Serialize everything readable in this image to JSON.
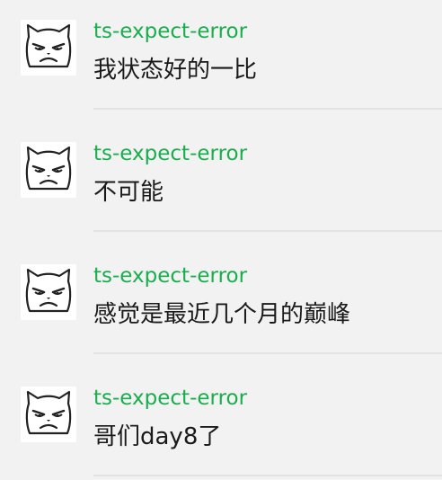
{
  "messages": [
    {
      "username": "ts-expect-error",
      "text": "我状态好的一比",
      "avatar_icon": "grumpy-cat-icon"
    },
    {
      "username": "ts-expect-error",
      "text": "不可能",
      "avatar_icon": "grumpy-cat-icon"
    },
    {
      "username": "ts-expect-error",
      "text": "感觉是最近几个月的巅峰",
      "avatar_icon": "grumpy-cat-icon"
    },
    {
      "username": "ts-expect-error",
      "text": "哥们day8了",
      "avatar_icon": "grumpy-cat-icon"
    }
  ],
  "colors": {
    "username": "#1aad4e",
    "text": "#1a1a1a",
    "background": "#f2f2f2",
    "divider": "#e3e3e3"
  }
}
